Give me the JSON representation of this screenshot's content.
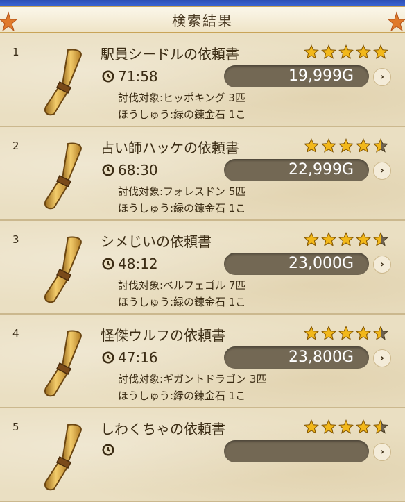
{
  "header": {
    "title": "検索結果"
  },
  "rows": [
    {
      "index": "1",
      "title": "駅員シードルの依頼書",
      "rating": 5,
      "time": "71:58",
      "price": "19,999G",
      "target": "討伐対象:ヒッポキング 3匹",
      "reward": "ほうしゅう:緑の錬金石 1こ"
    },
    {
      "index": "2",
      "title": "占い師ハッケの依頼書",
      "rating": 4.5,
      "time": "68:30",
      "price": "22,999G",
      "target": "討伐対象:フォレスドン 5匹",
      "reward": "ほうしゅう:緑の錬金石 1こ"
    },
    {
      "index": "3",
      "title": "シメじいの依頼書",
      "rating": 4.5,
      "time": "48:12",
      "price": "23,000G",
      "target": "討伐対象:ベルフェゴル 7匹",
      "reward": "ほうしゅう:緑の錬金石 1こ"
    },
    {
      "index": "4",
      "title": "怪傑ウルフの依頼書",
      "rating": 4.5,
      "time": "47:16",
      "price": "23,800G",
      "target": "討伐対象:ギガントドラゴン 3匹",
      "reward": "ほうしゅう:緑の錬金石 1こ"
    },
    {
      "index": "5",
      "title": "しわくちゃの依頼書",
      "rating": 4.5,
      "time": "",
      "price": "",
      "target": "",
      "reward": ""
    }
  ],
  "icons": {
    "time": "clock-icon",
    "item": "scroll-icon",
    "rating": "star-icon",
    "open": "chevron-right-icon"
  },
  "colors": {
    "star": "#f2b81a",
    "price_pill": "#736854",
    "header_border": "#c9a458"
  }
}
